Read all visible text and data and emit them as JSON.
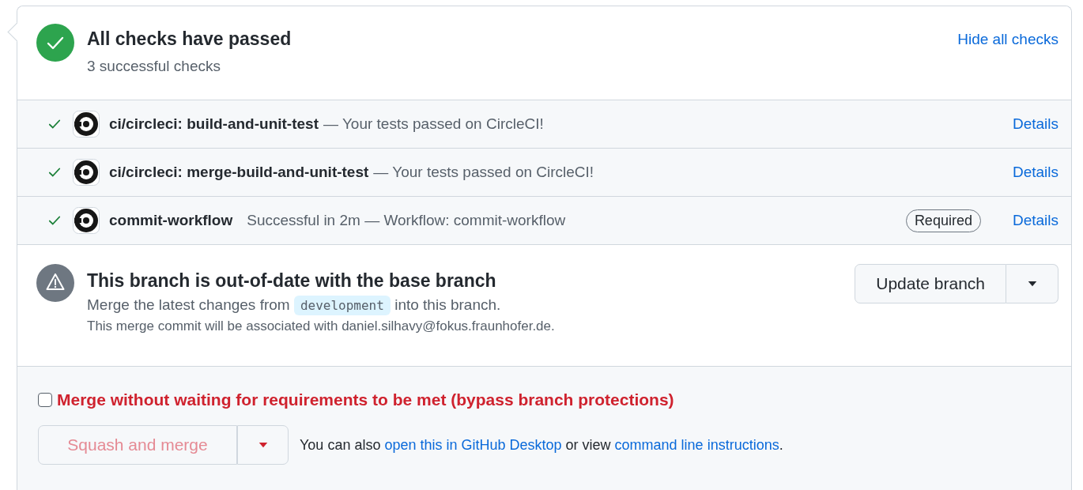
{
  "summary": {
    "title": "All checks have passed",
    "subtitle": "3 successful checks",
    "toggle_link": "Hide all checks",
    "passed": true
  },
  "checks": [
    {
      "kind": "commit_status",
      "passed": true,
      "name": "ci/circleci: build-and-unit-test",
      "description": "— Your tests passed on CircleCI!",
      "required": false,
      "details": "Details"
    },
    {
      "kind": "commit_status",
      "passed": true,
      "name": "ci/circleci: merge-build-and-unit-test",
      "description": "— Your tests passed on CircleCI!",
      "required": false,
      "details": "Details"
    },
    {
      "kind": "check_run",
      "passed": true,
      "name": "commit-workflow",
      "description": "Successful in 2m — Workflow: commit-workflow",
      "required": true,
      "required_label": "Required",
      "details": "Details"
    }
  ],
  "branch_status": {
    "title": "This branch is out-of-date with the base branch",
    "message_before": "Merge the latest changes from",
    "base_branch": "development",
    "message_after": "into this branch.",
    "note": "This merge commit will be associated with daniel.silhavy@fokus.fraunhofer.de.",
    "button": "Update branch"
  },
  "merge": {
    "bypass_label": "Merge without waiting for requirements to be met (bypass branch protections)",
    "bypass_checked": false,
    "button": "Squash and merge",
    "button_disabled": true,
    "hint": [
      {
        "kind": "text",
        "text": "You can also "
      },
      {
        "kind": "link",
        "text": "open this in GitHub Desktop"
      },
      {
        "kind": "text",
        "text": " or view "
      },
      {
        "kind": "link",
        "text": "command line instructions"
      },
      {
        "kind": "text",
        "text": "."
      }
    ]
  }
}
